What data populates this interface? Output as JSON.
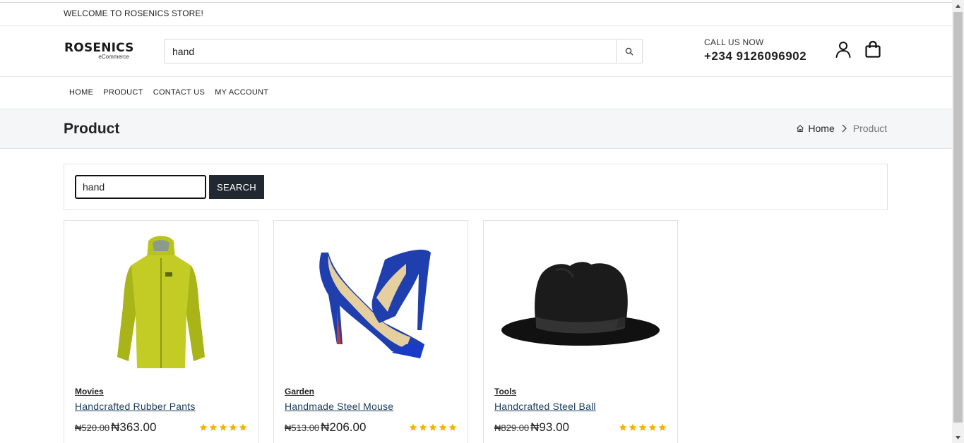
{
  "topbar": {
    "welcome": "WELCOME TO ROSENICS STORE!"
  },
  "header": {
    "logo_main": "ROSENICS",
    "logo_sub": "eCommerce",
    "search_value": "hand",
    "call_label": "CALL US NOW",
    "phone": "+234 9126096902"
  },
  "nav": {
    "items": [
      "HOME",
      "PRODUCT",
      "CONTACT US",
      "MY ACCOUNT"
    ]
  },
  "titlebar": {
    "title": "Product",
    "breadcrumb_home": "Home",
    "breadcrumb_current": "Product"
  },
  "product_search": {
    "value": "hand",
    "button": "SEARCH"
  },
  "products": [
    {
      "category": "Movies",
      "name": "Handcrafted Rubber Pants",
      "old_price": "₦520.00",
      "price": "₦363.00",
      "rating": 5
    },
    {
      "category": "Garden",
      "name": "Handmade Steel Mouse",
      "old_price": "₦513.00",
      "price": "₦206.00",
      "rating": 5
    },
    {
      "category": "Tools",
      "name": "Handcrafted Steel Ball",
      "old_price": "₦829.00",
      "price": "₦93.00",
      "rating": 5
    }
  ],
  "colors": {
    "accent": "#222831",
    "star": "#f5b301",
    "link": "#1a3b5c"
  },
  "icons": [
    "search-icon",
    "user-icon",
    "shopping-bag-icon",
    "home-icon",
    "chevron-right-icon",
    "star-icon"
  ]
}
